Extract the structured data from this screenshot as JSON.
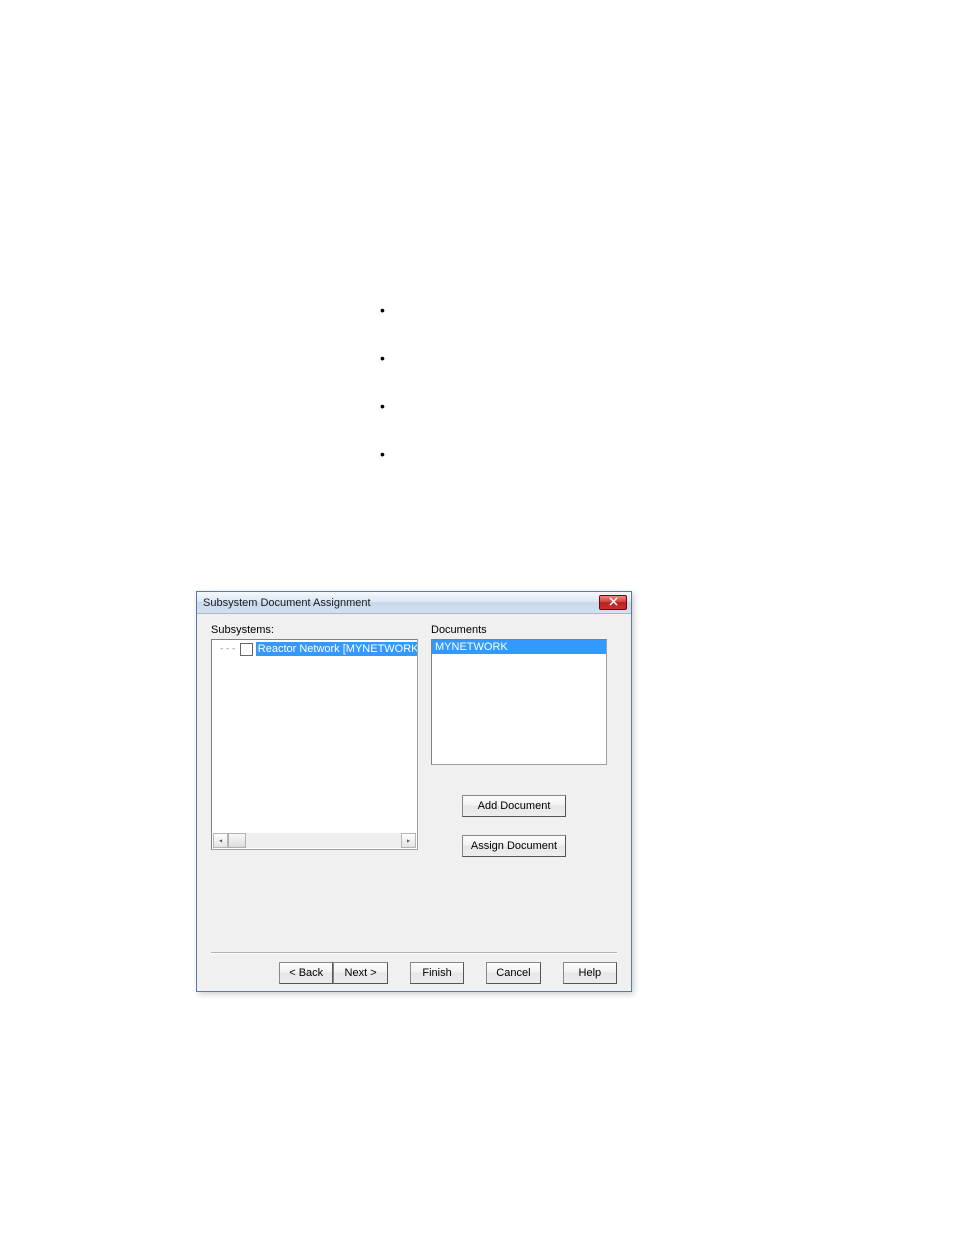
{
  "dialog": {
    "title": "Subsystem Document Assignment",
    "subsystems_label": "Subsystems:",
    "documents_label": "Documents",
    "tree": {
      "items": [
        {
          "label": "Reactor Network [MYNETWORK]",
          "checked": false,
          "selected": true
        }
      ]
    },
    "documents_list": [
      {
        "label": "MYNETWORK",
        "selected": true
      }
    ],
    "buttons": {
      "add_document": "Add Document",
      "assign_document": "Assign Document",
      "back": "< Back",
      "next": "Next >",
      "finish": "Finish",
      "cancel": "Cancel",
      "help": "Help"
    }
  }
}
